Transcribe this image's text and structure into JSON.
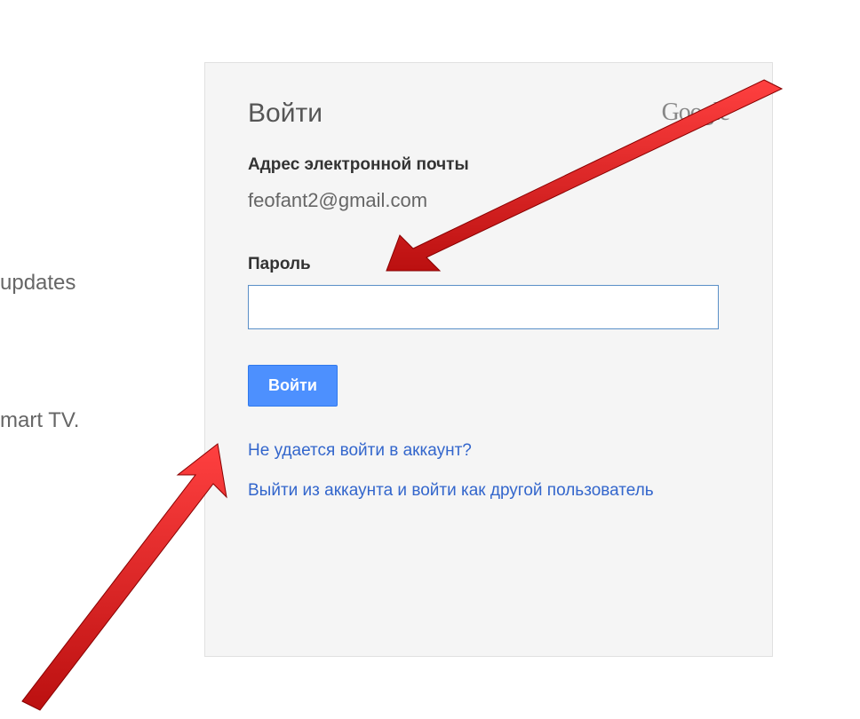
{
  "background": {
    "updates": "updates",
    "smarttv": "mart TV."
  },
  "login": {
    "title": "Войти",
    "brand": "Google",
    "email_label": "Адрес электронной почты",
    "email_value": "feofant2@gmail.com",
    "password_label": "Пароль",
    "password_value": "",
    "signin_button": "Войти",
    "cant_access_link": "Не удается войти в аккаунт?",
    "switch_account_link": "Выйти из аккаунта и войти как другой пользователь"
  }
}
